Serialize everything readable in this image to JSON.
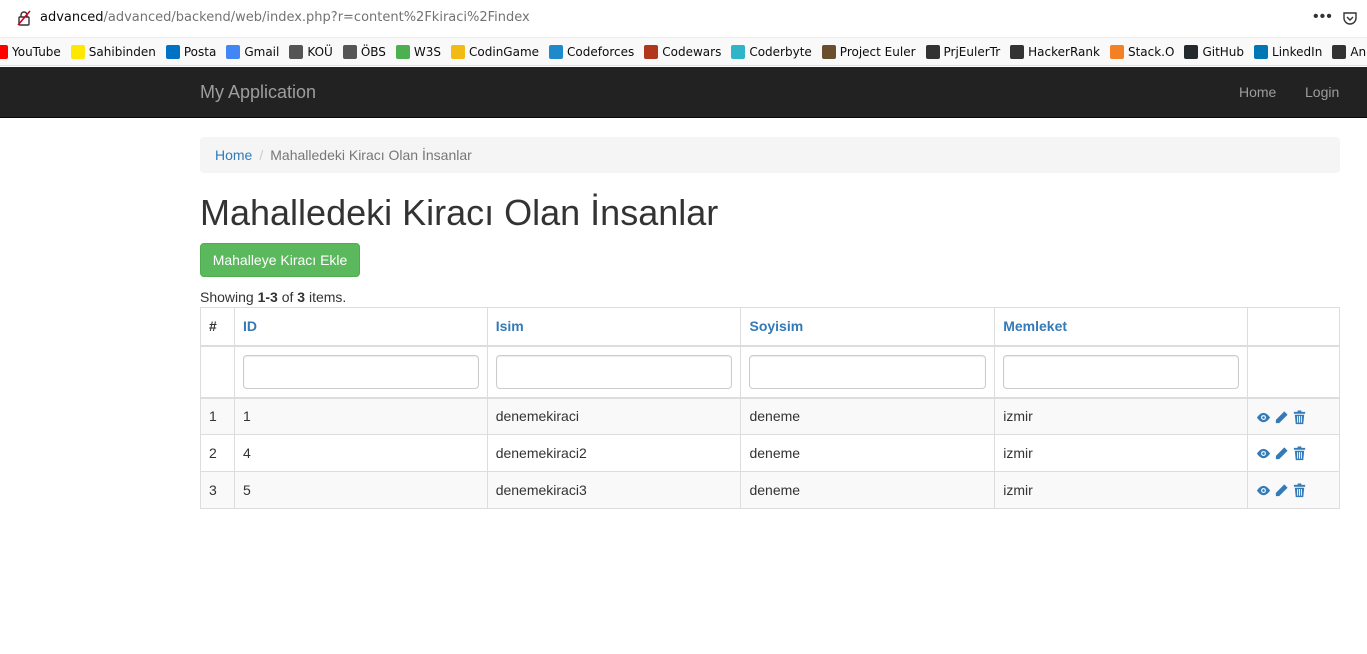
{
  "browser": {
    "url_host": "advanced",
    "url_rest": "/advanced/backend/web/index.php?r=content%2Fkiraci%2Findex",
    "more_label": "•••",
    "bookmarks": [
      {
        "label": "YouTube",
        "icon": "youtube-icon",
        "color": "#ff0000"
      },
      {
        "label": "Sahibinden",
        "icon": "sahibinden-icon",
        "color": "#ffe800"
      },
      {
        "label": "Posta",
        "icon": "outlook-icon",
        "color": "#0072c6"
      },
      {
        "label": "Gmail",
        "icon": "google-icon",
        "color": "#4285f4"
      },
      {
        "label": "KOÜ",
        "icon": "kou-icon",
        "color": "#555555"
      },
      {
        "label": "ÖBS",
        "icon": "obs-icon",
        "color": "#555555"
      },
      {
        "label": "W3S",
        "icon": "w3schools-icon",
        "color": "#4caf50"
      },
      {
        "label": "CodinGame",
        "icon": "codingame-icon",
        "color": "#f2bb13"
      },
      {
        "label": "Codeforces",
        "icon": "codeforces-icon",
        "color": "#1f8acb"
      },
      {
        "label": "Codewars",
        "icon": "codewars-icon",
        "color": "#b1361e"
      },
      {
        "label": "Coderbyte",
        "icon": "coderbyte-icon",
        "color": "#2eb6c8"
      },
      {
        "label": "Project Euler",
        "icon": "project-euler-icon",
        "color": "#6b4e2e"
      },
      {
        "label": "PrjEulerTr",
        "icon": "globe-icon",
        "color": "#333333"
      },
      {
        "label": "HackerRank",
        "icon": "globe-icon",
        "color": "#333333"
      },
      {
        "label": "Stack.O",
        "icon": "stackoverflow-icon",
        "color": "#f48024"
      },
      {
        "label": "GitHub",
        "icon": "github-icon",
        "color": "#24292e"
      },
      {
        "label": "LinkedIn",
        "icon": "linkedin-icon",
        "color": "#0077b5"
      },
      {
        "label": "Anket",
        "icon": "anket-icon",
        "color": "#333333"
      }
    ]
  },
  "navbar": {
    "brand": "My Application",
    "links": [
      {
        "label": "Home"
      },
      {
        "label": "Login"
      }
    ]
  },
  "breadcrumb": {
    "home": "Home",
    "separator": "/",
    "current": "Mahalledeki Kiracı Olan İnsanlar"
  },
  "page": {
    "title": "Mahalledeki Kiracı Olan İnsanlar",
    "add_button": "Mahalleye Kiracı Ekle",
    "summary_prefix": "Showing ",
    "summary_range": "1-3",
    "summary_of": " of ",
    "summary_total": "3",
    "summary_suffix": " items."
  },
  "table": {
    "columns": [
      "#",
      "ID",
      "Isim",
      "Soyisim",
      "Memleket"
    ],
    "rows": [
      [
        "1",
        "1",
        "denemekiraci",
        "deneme",
        "izmir"
      ],
      [
        "2",
        "4",
        "denemekiraci2",
        "deneme",
        "izmir"
      ],
      [
        "3",
        "5",
        "denemekiraci3",
        "deneme",
        "izmir"
      ]
    ],
    "row_actions": [
      "eye-icon",
      "pencil-icon",
      "trash-icon"
    ]
  },
  "colors": {
    "navbar_bg": "#222222",
    "link": "#337ab7",
    "success": "#5cb85c"
  }
}
